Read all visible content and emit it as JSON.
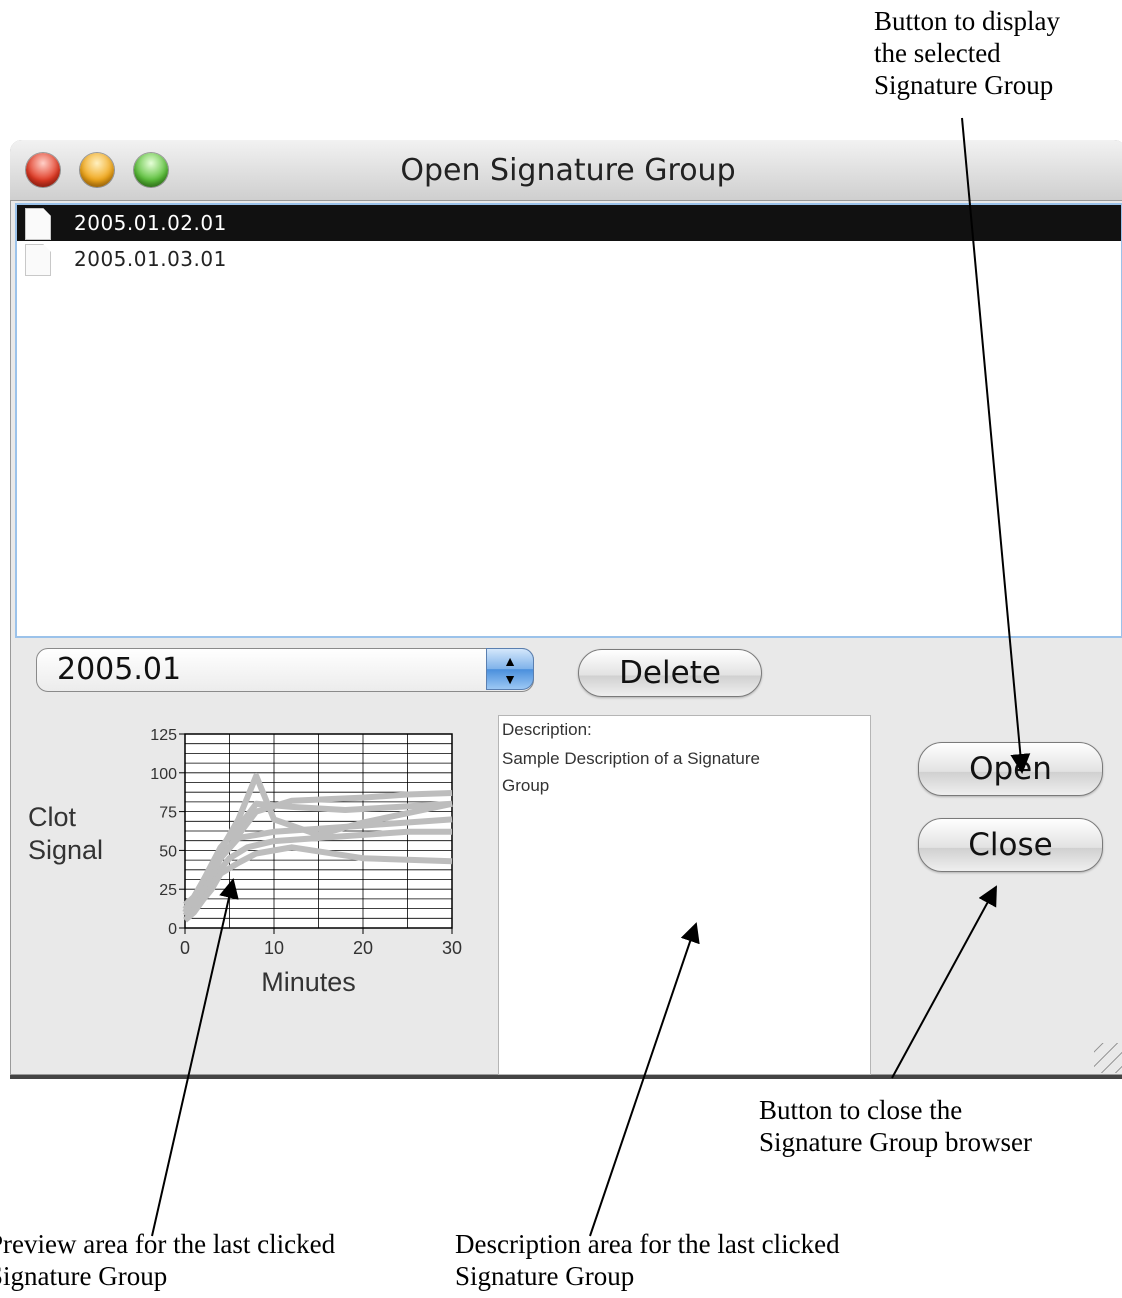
{
  "annotations": {
    "open_note": "Button to display\nthe selected\nSignature Group",
    "close_note": "Button to close the\nSignature Group browser",
    "preview_note": "Preview area for the last clicked\nSignature Group",
    "description_note": "Description area for the last clicked\nSignature Group"
  },
  "window": {
    "title": "Open Signature Group",
    "traffic_lights": {
      "close": "#e03a24",
      "minimize": "#f0a61a",
      "zoom": "#5bbf3a"
    }
  },
  "file_list": {
    "items": [
      {
        "name": "2005.01.02.01",
        "selected": true,
        "icon": "document-icon"
      },
      {
        "name": "2005.01.03.01",
        "selected": false,
        "icon": "document-icon"
      }
    ]
  },
  "group_popup": {
    "value": "2005.01"
  },
  "buttons": {
    "delete": "Delete",
    "open": "Open",
    "close": "Close"
  },
  "description": {
    "label": "Description:",
    "text": "Sample Description of a Signature Group"
  },
  "chart_data": {
    "type": "line",
    "xlabel": "Minutes",
    "ylabel": "Clot\nSignal",
    "x_ticks": [
      0,
      10,
      20,
      30
    ],
    "y_ticks": [
      0,
      25,
      50,
      75,
      100,
      125
    ],
    "xlim": [
      0,
      30
    ],
    "ylim": [
      0,
      125
    ],
    "grid": true,
    "line_color": "#bdbdbd",
    "series": [
      {
        "x": [
          0,
          1,
          2,
          3,
          4,
          5,
          7,
          10,
          15,
          20,
          25,
          30
        ],
        "y": [
          10,
          15,
          22,
          30,
          38,
          45,
          52,
          56,
          58,
          60,
          62,
          62
        ]
      },
      {
        "x": [
          0,
          1,
          2,
          3,
          4,
          5,
          6,
          8,
          10,
          15,
          20,
          25,
          30
        ],
        "y": [
          12,
          20,
          30,
          40,
          50,
          60,
          70,
          98,
          70,
          60,
          68,
          74,
          80
        ]
      },
      {
        "x": [
          0,
          1,
          2,
          3,
          4,
          6,
          8,
          12,
          20,
          25,
          30
        ],
        "y": [
          8,
          14,
          22,
          35,
          45,
          60,
          75,
          82,
          84,
          86,
          87
        ]
      },
      {
        "x": [
          0,
          1,
          2,
          3,
          4,
          6,
          8,
          12,
          20,
          30
        ],
        "y": [
          5,
          10,
          18,
          25,
          35,
          42,
          48,
          52,
          45,
          43
        ]
      },
      {
        "x": [
          0,
          2,
          4,
          6,
          10,
          15,
          20,
          25,
          30
        ],
        "y": [
          15,
          25,
          45,
          58,
          62,
          64,
          66,
          68,
          70
        ]
      },
      {
        "x": [
          0,
          2,
          4,
          6,
          8,
          12,
          18,
          24,
          30
        ],
        "y": [
          10,
          30,
          52,
          65,
          80,
          78,
          76,
          78,
          80
        ]
      }
    ]
  }
}
